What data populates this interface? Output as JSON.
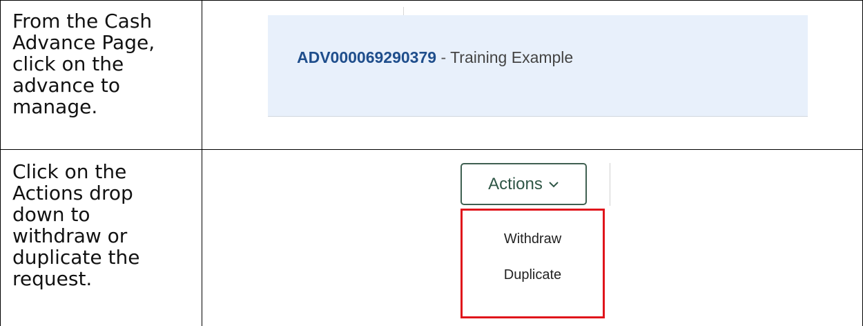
{
  "rows": [
    {
      "instruction_lines": [
        "From the Cash",
        "Advance Page,",
        "click on the",
        "advance to",
        "manage."
      ]
    },
    {
      "instruction_lines": [
        "Click on the",
        "Actions drop",
        "down to",
        "withdraw or",
        "duplicate the",
        "request."
      ]
    }
  ],
  "advance_card": {
    "id": "ADV000069290379",
    "separator": " - ",
    "name": "Training Example"
  },
  "actions": {
    "label": "Actions",
    "icon": "chevron-down-icon",
    "menu_items": [
      "Withdraw",
      "Duplicate"
    ]
  },
  "colors": {
    "card_background": "#e8f0fb",
    "advance_id": "#1f4e8c",
    "button_border": "#3e5f50",
    "highlight_box": "#e0141b"
  }
}
